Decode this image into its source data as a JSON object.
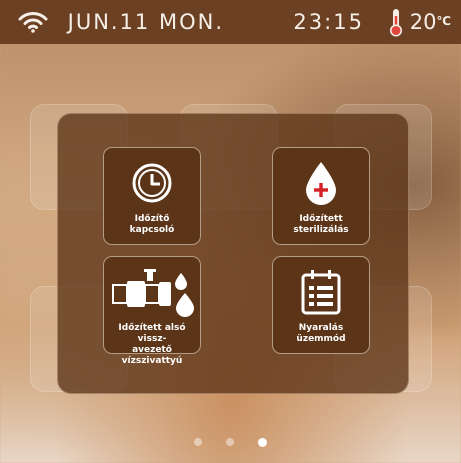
{
  "status": {
    "date": "JUN.11 MON.",
    "time": "23:15",
    "temperature_value": "20",
    "temperature_unit": "℃",
    "icons": [
      "wifi-icon",
      "thermometer-icon"
    ]
  },
  "menu": {
    "tiles": [
      {
        "label": "Időzítő\nkapcsoló",
        "icon": "timer-icon"
      },
      {
        "label": "Időzített\nsterilizálás",
        "icon": "sterilization-drop-icon"
      },
      {
        "label": "Időzített alsó vissz-\navezető vízszivattyú",
        "icon": "pump-icon"
      },
      {
        "label": "Nyaralás\nüzemmód",
        "icon": "calendar-list-icon"
      }
    ]
  },
  "pager": {
    "pages": 3,
    "active_page": 3
  },
  "colors": {
    "status_bar": "#6b4023",
    "panel": "#5c3518",
    "accent_red": "#d61f26"
  }
}
